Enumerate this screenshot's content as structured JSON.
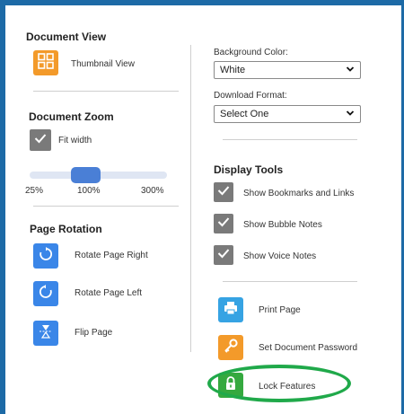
{
  "document_view": {
    "heading": "Document View",
    "thumbnail_label": "Thumbnail View"
  },
  "document_zoom": {
    "heading": "Document Zoom",
    "fit_width_label": "Fit width",
    "fit_width_checked": true,
    "slider_value_percent": 100,
    "ticks": [
      "25%",
      "100%",
      "300%"
    ]
  },
  "page_rotation": {
    "heading": "Page Rotation",
    "rotate_right": "Rotate Page Right",
    "rotate_left": "Rotate Page Left",
    "flip": "Flip Page"
  },
  "background": {
    "label": "Background Color:",
    "value": "White"
  },
  "download": {
    "label": "Download Format:",
    "value": "Select One"
  },
  "display_tools": {
    "heading": "Display Tools",
    "items": [
      {
        "label": "Show Bookmarks and Links",
        "checked": true
      },
      {
        "label": "Show Bubble Notes",
        "checked": true
      },
      {
        "label": "Show Voice Notes",
        "checked": true
      }
    ]
  },
  "actions": {
    "print": "Print Page",
    "password": "Set Document Password",
    "lock": "Lock Features"
  },
  "colors": {
    "frame": "#1d6aa6",
    "orange": "#f39a2a",
    "blue": "#3a86e8",
    "print_blue": "#36a3e3",
    "green": "#35a93f",
    "check_gray": "#7a7a7a",
    "highlight_ring": "#20a94a"
  }
}
